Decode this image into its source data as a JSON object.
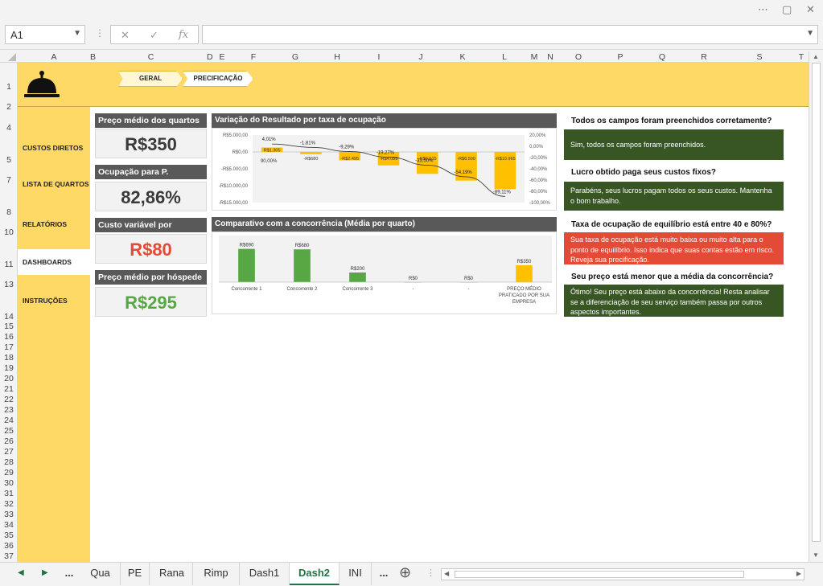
{
  "window": {
    "more_icon": "⋯",
    "restore_icon": "▢",
    "close_icon": "✕"
  },
  "formula_bar": {
    "name_box": "A1",
    "formula": "",
    "fx_label": "fx"
  },
  "columns": [
    "A",
    "B",
    "C",
    "D",
    "E",
    "F",
    "G",
    "H",
    "I",
    "J",
    "K",
    "L",
    "M",
    "N",
    "O",
    "P",
    "Q",
    "R",
    "S",
    "T"
  ],
  "nav_pills": [
    "GERAL",
    "PRECIFICAÇÃO"
  ],
  "sidebar": {
    "items": [
      {
        "label": "CUSTOS DIRETOS",
        "active": false
      },
      {
        "label": "LISTA DE QUARTOS",
        "active": false
      },
      {
        "label": "RELATÓRIOS",
        "active": false
      },
      {
        "label": "DASHBOARDS",
        "active": true
      },
      {
        "label": "INSTRUÇÕES",
        "active": false
      }
    ]
  },
  "kpis": [
    {
      "title": "Preço médio dos quartos",
      "value": "R$350",
      "color": "#3a3a3a"
    },
    {
      "title": "Ocupação para P. Equilíbrio",
      "value": "82,86%",
      "color": "#3a3a3a"
    },
    {
      "title": "Custo variável por hóspede",
      "value": "R$80",
      "color": "#e34b36"
    },
    {
      "title": "Preço médio por hóspede",
      "value": "R$295",
      "color": "#57a845"
    }
  ],
  "charts": {
    "variacao": {
      "title": "Variação do Resultado por taxa de ocupação"
    },
    "comparativo": {
      "title": "Comparativo com a concorrência (Média por quarto)"
    }
  },
  "chart_data": [
    {
      "type": "bar",
      "title": "Variação do Resultado por taxa de ocupação",
      "y_ticks": [
        "R$5.000,00",
        "R$0,00",
        "-R$5.000,00",
        "-R$10.000,00",
        "-R$15.000,00"
      ],
      "y2_ticks": [
        "20,00%",
        "0,00%",
        "-20,00%",
        "-40,00%",
        "-60,00%",
        "-80,00%",
        "-100,00%"
      ],
      "ylim": [
        -15000,
        5000
      ],
      "y2lim": [
        -100,
        20
      ],
      "series": [
        {
          "values": [
            1305,
            -680,
            -2500,
            -4000,
            -6500,
            -8500,
            -11000
          ],
          "color": "#ffc000"
        },
        {
          "values": [
            4.01,
            -1.81,
            -9.29,
            -19.27,
            -33.5,
            -54.19,
            -89.11
          ],
          "color": "#404040"
        }
      ],
      "bar_labels": [
        "R$1.305",
        "-R$680",
        "-R$2.495",
        "-R$4.055",
        "-R$6.515",
        "-R$8.500",
        "-R$10.965"
      ],
      "line_labels": [
        "4,01%",
        "-1,81%",
        "-9,29%",
        "-19,27%",
        "-33,50%",
        "-54,19%",
        "-89,11%"
      ],
      "first_category": "90,00%"
    },
    {
      "type": "bar",
      "title": "Comparativo com a concorrência (Média por quarto)",
      "categories": [
        "Concorrente 1",
        "Concorrente 2",
        "Concorrente 3",
        "-",
        "-",
        "PREÇO MÉDIO PRATICADO POR SUA EMPRESA"
      ],
      "values": [
        690,
        680,
        200,
        0,
        0,
        350
      ],
      "labels": [
        "R$690",
        "R$680",
        "R$200",
        "R$0",
        "R$0",
        "R$350"
      ],
      "colors": [
        "#57a845",
        "#57a845",
        "#57a845",
        "#57a845",
        "#57a845",
        "#ffc000"
      ],
      "ylim": [
        0,
        800
      ]
    }
  ],
  "checks": [
    {
      "question": "Todos os campos foram preenchidos corretamente?",
      "answer": "Sim, todos os campos foram preenchidos.",
      "color": "#375623"
    },
    {
      "question": "Lucro obtido paga seus custos fixos?",
      "answer": "Parabéns, seus lucros pagam todos os seus custos. Mantenha o bom trabalho.",
      "color": "#375623"
    },
    {
      "question": "Taxa de ocupação de equilíbrio está entre 40 e 80%?",
      "answer": "Sua taxa de ocupação está muito baixa ou muito alta para o ponto de equilíbrio. Isso indica que suas contas estão em risco. Reveja sua precificação.",
      "color": "#e34b36"
    },
    {
      "question": "Seu preço está menor que a média da concorrência?",
      "answer": "Ótimo! Seu preço está abaixo da concorrência! Resta analisar se a diferenciação de seu serviço também passa por outros aspectos importantes.",
      "color": "#375623"
    }
  ],
  "tabs": {
    "items": [
      "...",
      "Qua",
      "PE",
      "Rana",
      "Rimp",
      "Dash1",
      "Dash2",
      "INI",
      "..."
    ],
    "active": "Dash2",
    "add_icon": "⊕"
  }
}
